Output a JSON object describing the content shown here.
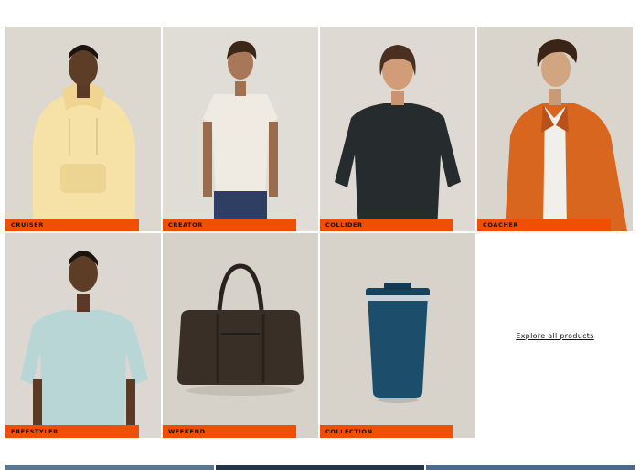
{
  "products": [
    {
      "label": "CRUISER",
      "bg": "#dcd8d0"
    },
    {
      "label": "CREATOR",
      "bg": "#e0ddd7"
    },
    {
      "label": "COLLIDER",
      "bg": "#dedad3"
    },
    {
      "label": "COACHER",
      "bg": "#d9d4cc"
    },
    {
      "label": "FREESTYLER",
      "bg": "#dcd8d1"
    },
    {
      "label": "WEEKEND",
      "bg": "#d6d1c9"
    },
    {
      "label": "COLLECTION",
      "bg": "#d7d2ca"
    }
  ],
  "explore_link": "Explore all products",
  "colors": {
    "tag": "#f04e00",
    "strip": [
      "#5c7590",
      "#253347",
      "#4b6a8c"
    ]
  }
}
